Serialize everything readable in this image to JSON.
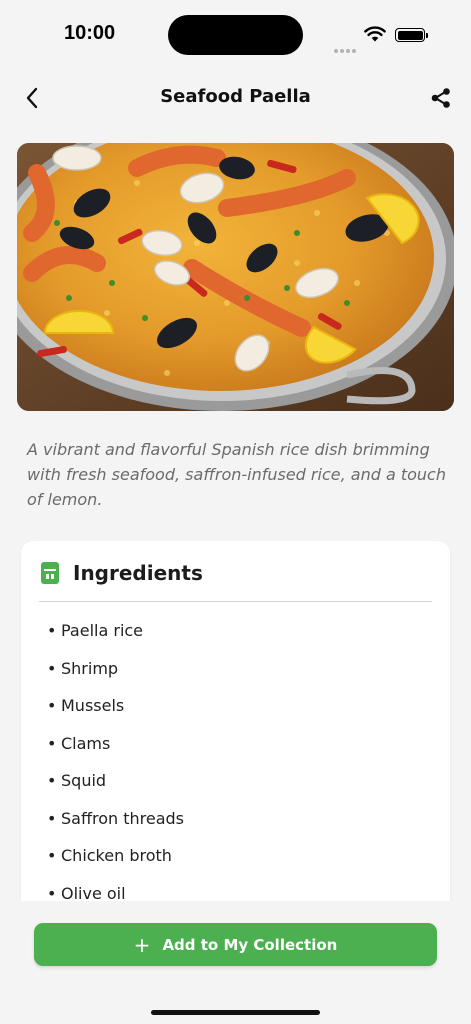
{
  "status_bar": {
    "time": "10:00"
  },
  "nav": {
    "title": "Seafood Paella",
    "back_icon": "chevron-left-icon",
    "share_icon": "share-icon"
  },
  "description": "A vibrant and flavorful Spanish rice dish brimming with fresh seafood, saffron-infused rice, and a touch of lemon.",
  "ingredients": {
    "title": "Ingredients",
    "icon": "ingredients-icon",
    "items": [
      "Paella rice",
      "Shrimp",
      "Mussels",
      "Clams",
      "Squid",
      "Saffron threads",
      "Chicken broth",
      "Olive oil"
    ]
  },
  "action": {
    "add_label": "Add to My Collection",
    "plus_icon": "plus-icon"
  },
  "colors": {
    "accent": "#4caf50",
    "background": "#f4f4f4",
    "card": "#ffffff",
    "description_text": "#6b6b6b"
  }
}
